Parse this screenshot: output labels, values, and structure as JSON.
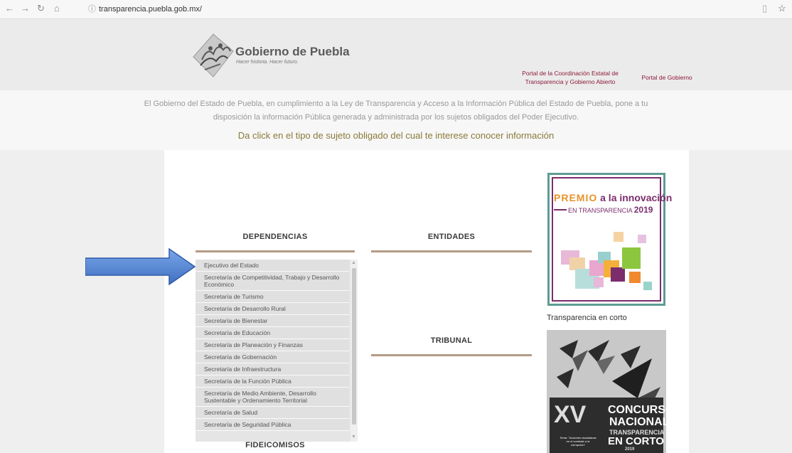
{
  "browser": {
    "url": "transparencia.puebla.gob.mx/",
    "back_glyph": "←",
    "forward_glyph": "→",
    "reload_glyph": "↻",
    "home_glyph": "⌂",
    "info_glyph": "ⓘ",
    "reader_glyph": "▯",
    "star_glyph": "☆"
  },
  "header": {
    "logo_title": "Gobierno de Puebla",
    "logo_subtitle": "Hacer historia. Hacer futuro.",
    "link_coordinacion_1": "Portal de la Coordinación Estatal de",
    "link_coordinacion_2": "Transparencia y Gobierno Abierto",
    "link_gobierno": "Portal de Gobierno"
  },
  "intro": {
    "line1": "El Gobierno del Estado de Puebla, en cumplimiento a la Ley de Transparencia y Acceso a la Información Pública del Estado de Puebla, pone a tu",
    "line2": "disposición la información Pública generada y administrada por los sujetos obligados del Poder Ejecutivo.",
    "cta": "Da click en el tipo de sujeto obligado del cual te interese conocer información"
  },
  "sections": {
    "dependencias": "DEPENDENCIAS",
    "entidades": "ENTIDADES",
    "tribunal": "TRIBUNAL",
    "fideicomisos": "FIDEICOMISOS"
  },
  "dependencias_list": [
    "Ejecutivo del Estado",
    "Secretaría de Competitividad, Trabajo y Desarrollo Económico",
    "Secretaría de Turismo",
    "Secretaría de Desarrollo Rural",
    "Secretaría de Bienestar",
    "Secretaría de Educación",
    "Secretaría de Planeación y Finanzas",
    "Secretaría de Gobernación",
    "Secretaría de Infraestructura",
    "Secretaría de la Función Pública",
    "Secretaría de Medio Ambiente, Desarrollo Sustentable y Ordenamiento Territorial",
    "Secretaría de Salud",
    "Secretaría de Seguridad Pública"
  ],
  "sidebar": {
    "premio_word": "PREMIO",
    "premio_rest": " a la innovación",
    "premio_sub": "EN TRANSPARENCIA",
    "premio_year": "2019",
    "transparencia_corto": "Transparencia en corto",
    "corto_roman": "XV",
    "corto_concurso": "CONCURSO",
    "corto_nacional": "NACIONAL",
    "corto_transparencia": "TRANSPARENCIA",
    "corto_en_corto": "EN CORTO",
    "corto_year": "2019",
    "corto_tema_1": "Tema: \"Acciones ciudadanas",
    "corto_tema_2": "en el combate a la",
    "corto_tema_3": "corrupción\""
  },
  "colors": {
    "accent_maroon": "#8b1a3a",
    "rule_tan": "#b49b86",
    "cta_olive": "#8a7a3a",
    "arrow_blue": "#4a78c9"
  }
}
